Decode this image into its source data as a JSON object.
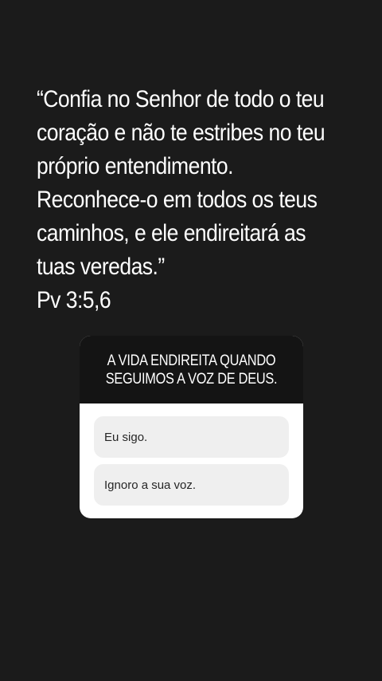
{
  "story": {
    "quote_lines": [
      "“Confia no Senhor de todo o teu",
      "coração e não te estribes no teu",
      "próprio entendimento.",
      "Reconhece-o em todos os teus",
      "caminhos, e ele endireitará as",
      "tuas veredas.”",
      "Pv 3:5,6"
    ]
  },
  "poll": {
    "question_lines": [
      "A VIDA ENDIREITA QUANDO",
      "SEGUIMOS A VOZ DE DEUS."
    ],
    "options": [
      {
        "label": "Eu sigo."
      },
      {
        "label": "Ignoro a sua voz."
      }
    ]
  },
  "colors": {
    "background": "#1b1b1b",
    "poll_header": "#141414",
    "option_bg": "#efefef"
  }
}
